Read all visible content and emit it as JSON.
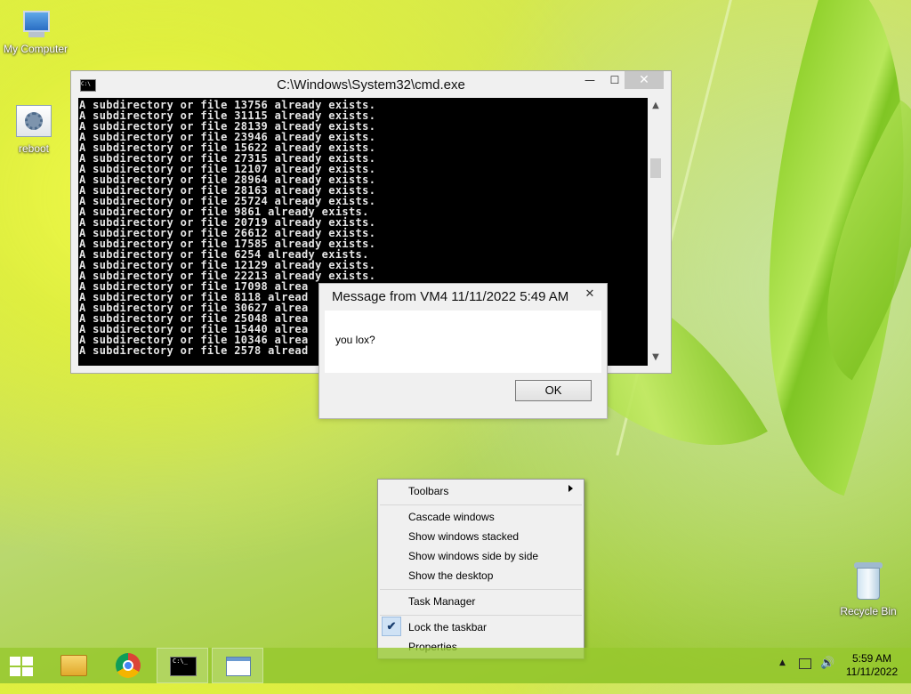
{
  "desktop": {
    "icons": [
      {
        "label": "My Computer"
      },
      {
        "label": "reboot"
      },
      {
        "label": "Recycle Bin"
      }
    ]
  },
  "cmd_window": {
    "title": "C:\\Windows\\System32\\cmd.exe",
    "lines": [
      "A subdirectory or file 13756 already exists.",
      "A subdirectory or file 31115 already exists.",
      "A subdirectory or file 28139 already exists.",
      "A subdirectory or file 23946 already exists.",
      "A subdirectory or file 15622 already exists.",
      "A subdirectory or file 27315 already exists.",
      "A subdirectory or file 12107 already exists.",
      "A subdirectory or file 28964 already exists.",
      "A subdirectory or file 28163 already exists.",
      "A subdirectory or file 25724 already exists.",
      "A subdirectory or file 9861 already exists.",
      "A subdirectory or file 20719 already exists.",
      "A subdirectory or file 26612 already exists.",
      "A subdirectory or file 17585 already exists.",
      "A subdirectory or file 6254 already exists.",
      "A subdirectory or file 12129 already exists.",
      "A subdirectory or file 22213 already exists.",
      "A subdirectory or file 17098 alrea",
      "A subdirectory or file 8118 alread",
      "A subdirectory or file 30627 alrea",
      "A subdirectory or file 25048 alrea",
      "A subdirectory or file 15440 alrea",
      "A subdirectory or file 10346 alrea",
      "A subdirectory or file 2578 alread"
    ],
    "buttons": {
      "minimize": "—",
      "maximize": "☐",
      "close": "✕"
    }
  },
  "message_box": {
    "title": "Message from VM4 11/11/2022 5:49 AM",
    "text": "you lox?",
    "ok_label": "OK",
    "close": "✕"
  },
  "context_menu": {
    "items": [
      {
        "label": "Toolbars",
        "submenu": true
      },
      {
        "label": "Cascade windows"
      },
      {
        "label": "Show windows stacked"
      },
      {
        "label": "Show windows side by side"
      },
      {
        "label": "Show the desktop"
      },
      {
        "label": "Task Manager"
      },
      {
        "label": "Lock the taskbar",
        "checked": true
      },
      {
        "label": "Properties"
      }
    ]
  },
  "taskbar": {
    "apps": [
      "start-icon",
      "file-explorer-icon",
      "chrome-icon",
      "cmd-icon",
      "message-window-icon"
    ],
    "active_app": "cmd-icon",
    "clock": {
      "time": "5:59 AM",
      "date": "11/11/2022"
    },
    "tray_icons": [
      "show-hidden-icons-icon",
      "network-icon",
      "volume-icon"
    ],
    "accent": "#8fc129"
  }
}
